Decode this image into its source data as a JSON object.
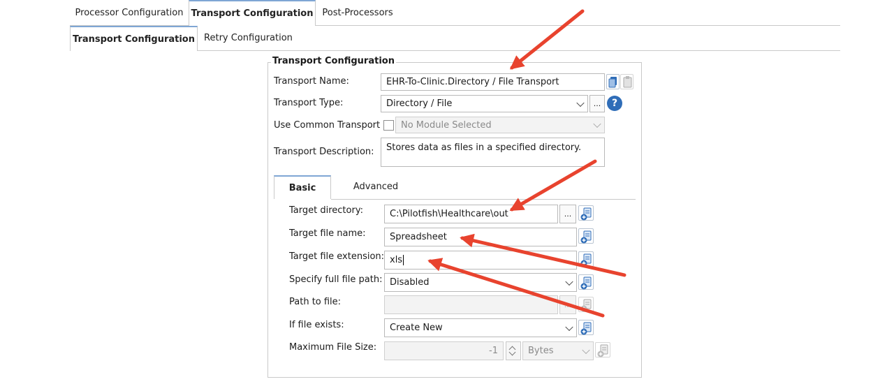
{
  "main_tabs": [
    {
      "label": "Processor Configuration"
    },
    {
      "label": "Transport Configuration"
    },
    {
      "label": "Post-Processors"
    }
  ],
  "sub_tabs": [
    {
      "label": "Transport Configuration"
    },
    {
      "label": "Retry Configuration"
    }
  ],
  "group": {
    "title": "Transport Configuration",
    "transport_name": {
      "label": "Transport Name:",
      "value": "EHR-To-Clinic.Directory / File Transport"
    },
    "transport_type": {
      "label": "Transport Type:",
      "value": "Directory / File",
      "browse": "..."
    },
    "help": "?",
    "common_transport": {
      "label": "Use Common Transport",
      "value": "No Module Selected"
    },
    "description": {
      "label": "Transport Description:",
      "value": "Stores data as files in a specified directory."
    }
  },
  "inner_tabs": [
    {
      "label": "Basic"
    },
    {
      "label": "Advanced"
    }
  ],
  "basic": {
    "target_directory": {
      "label": "Target directory:",
      "value": "C:\\Pilotfish\\Healthcare\\out",
      "browse": "..."
    },
    "target_file_name": {
      "label": "Target file name:",
      "value": "Spreadsheet"
    },
    "target_file_extension": {
      "label": "Target file extension:",
      "value": "xls"
    },
    "full_file_path": {
      "label": "Specify full file path:",
      "value": "Disabled"
    },
    "path_to_file": {
      "label": "Path to file:",
      "value": "",
      "browse": "..."
    },
    "if_file_exists": {
      "label": "If file exists:",
      "value": "Create New"
    },
    "max_file_size": {
      "label": "Maximum File Size:",
      "value": "-1",
      "unit": "Bytes"
    }
  },
  "colors": {
    "accent": "#2f6db8",
    "annotation_arrow": "#e8432e"
  }
}
